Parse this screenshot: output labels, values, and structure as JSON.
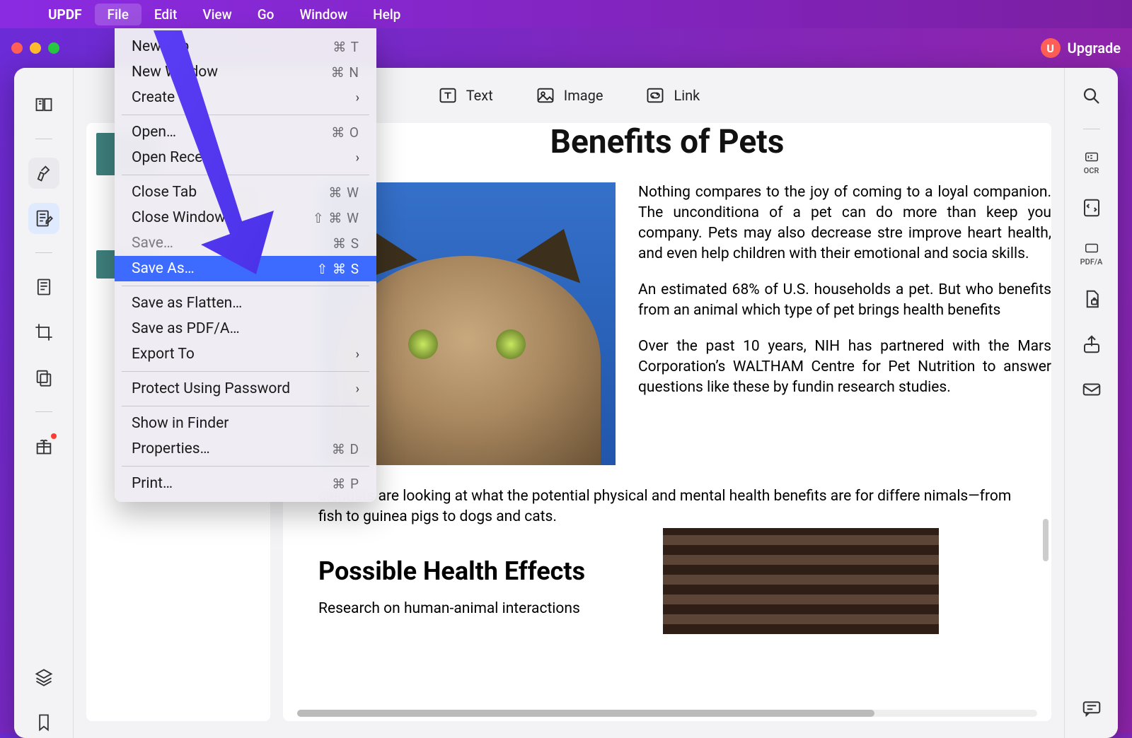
{
  "menubar": {
    "app": "UPDF",
    "items": [
      "File",
      "Edit",
      "View",
      "Go",
      "Window",
      "Help"
    ],
    "open_index": 0
  },
  "titlebar": {
    "upgrade_label": "Upgrade",
    "badge_letter": "U"
  },
  "file_menu": {
    "groups": [
      [
        {
          "label": "New Tab",
          "shortcut": "⌘ T"
        },
        {
          "label": "New Window",
          "shortcut": "⌘ N"
        },
        {
          "label": "Create",
          "submenu": true
        }
      ],
      [
        {
          "label": "Open…",
          "shortcut": "⌘ O"
        },
        {
          "label": "Open Recent",
          "submenu": true
        }
      ],
      [
        {
          "label": "Close Tab",
          "shortcut": "⌘ W"
        },
        {
          "label": "Close Window",
          "shortcut": "⇧ ⌘ W"
        },
        {
          "label": "Save…",
          "shortcut": "⌘ S",
          "disabled": true
        },
        {
          "label": "Save As…",
          "shortcut": "⇧ ⌘ S",
          "selected": true
        }
      ],
      [
        {
          "label": "Save as Flatten…"
        },
        {
          "label": "Save as PDF/A…"
        },
        {
          "label": "Export To",
          "submenu": true
        }
      ],
      [
        {
          "label": "Protect Using Password",
          "submenu": true
        }
      ],
      [
        {
          "label": "Show in Finder"
        },
        {
          "label": "Properties…",
          "shortcut": "⌘ D"
        }
      ],
      [
        {
          "label": "Print…",
          "shortcut": "⌘ P"
        }
      ]
    ]
  },
  "top_tools": {
    "text": "Text",
    "image": "Image",
    "link": "Link"
  },
  "right_toolbar": {
    "ocr": "OCR",
    "pdfa": "PDF/A"
  },
  "document": {
    "title": "Benefits of Pets",
    "para1": "Nothing compares to the joy of coming to a loyal companion. The unconditiona of a pet can do more than keep you company. Pets may also decrease stre improve heart health, and even help children with their emotional and socia skills.",
    "para2": "An estimated 68% of U.S. households a pet. But who benefits from an animal which type of pet brings health benefits",
    "para3": "Over the past 10 years, NIH has partnered with the Mars Corporation’s WALTHAM Centre for Pet Nutrition to answer questions like these by fundin research studies.",
    "para4": "cientists are looking at what the potential physical and mental health benefits are for differe nimals—from fish to guinea pigs to dogs and cats.",
    "h2": "Possible Health Effects",
    "para5": "Research on human-animal interactions"
  }
}
